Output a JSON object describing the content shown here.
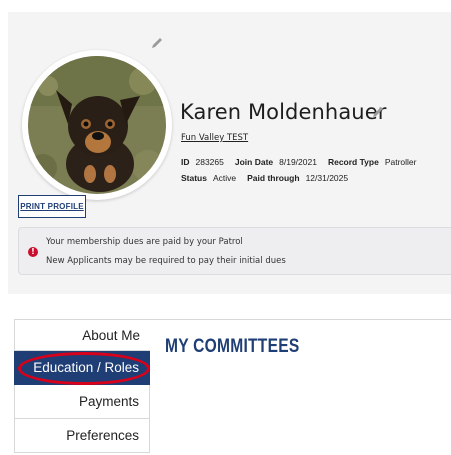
{
  "profile": {
    "name": "Karen Moldenhauer",
    "affiliation": "Fun Valley TEST",
    "fields": {
      "id_label": "ID",
      "id_value": "283265",
      "join_label": "Join Date",
      "join_value": "8/19/2021",
      "record_label": "Record Type",
      "record_value": "Patroller",
      "status_label": "Status",
      "status_value": "Active",
      "paid_label": "Paid through",
      "paid_value": "12/31/2025"
    },
    "print_button": "PRINT PROFILE",
    "icons": {
      "edit_photo": "pencil-icon",
      "edit_name": "pencil-icon",
      "alert": "exclamation-circle-icon"
    },
    "colors": {
      "accent": "#1f3e75",
      "alert": "#c8102e",
      "highlight_ring": "#d8001a"
    }
  },
  "notice": {
    "alert_glyph": "!",
    "line1": "Your membership dues are paid by your Patrol",
    "line2": "New Applicants may be required to pay their initial dues"
  },
  "menu": {
    "items": [
      {
        "label": "About Me",
        "active": false
      },
      {
        "label": "Education / Roles",
        "active": true
      },
      {
        "label": "Payments",
        "active": false
      },
      {
        "label": "Preferences",
        "active": false
      }
    ]
  },
  "main": {
    "heading": "MY COMMITTEES"
  }
}
